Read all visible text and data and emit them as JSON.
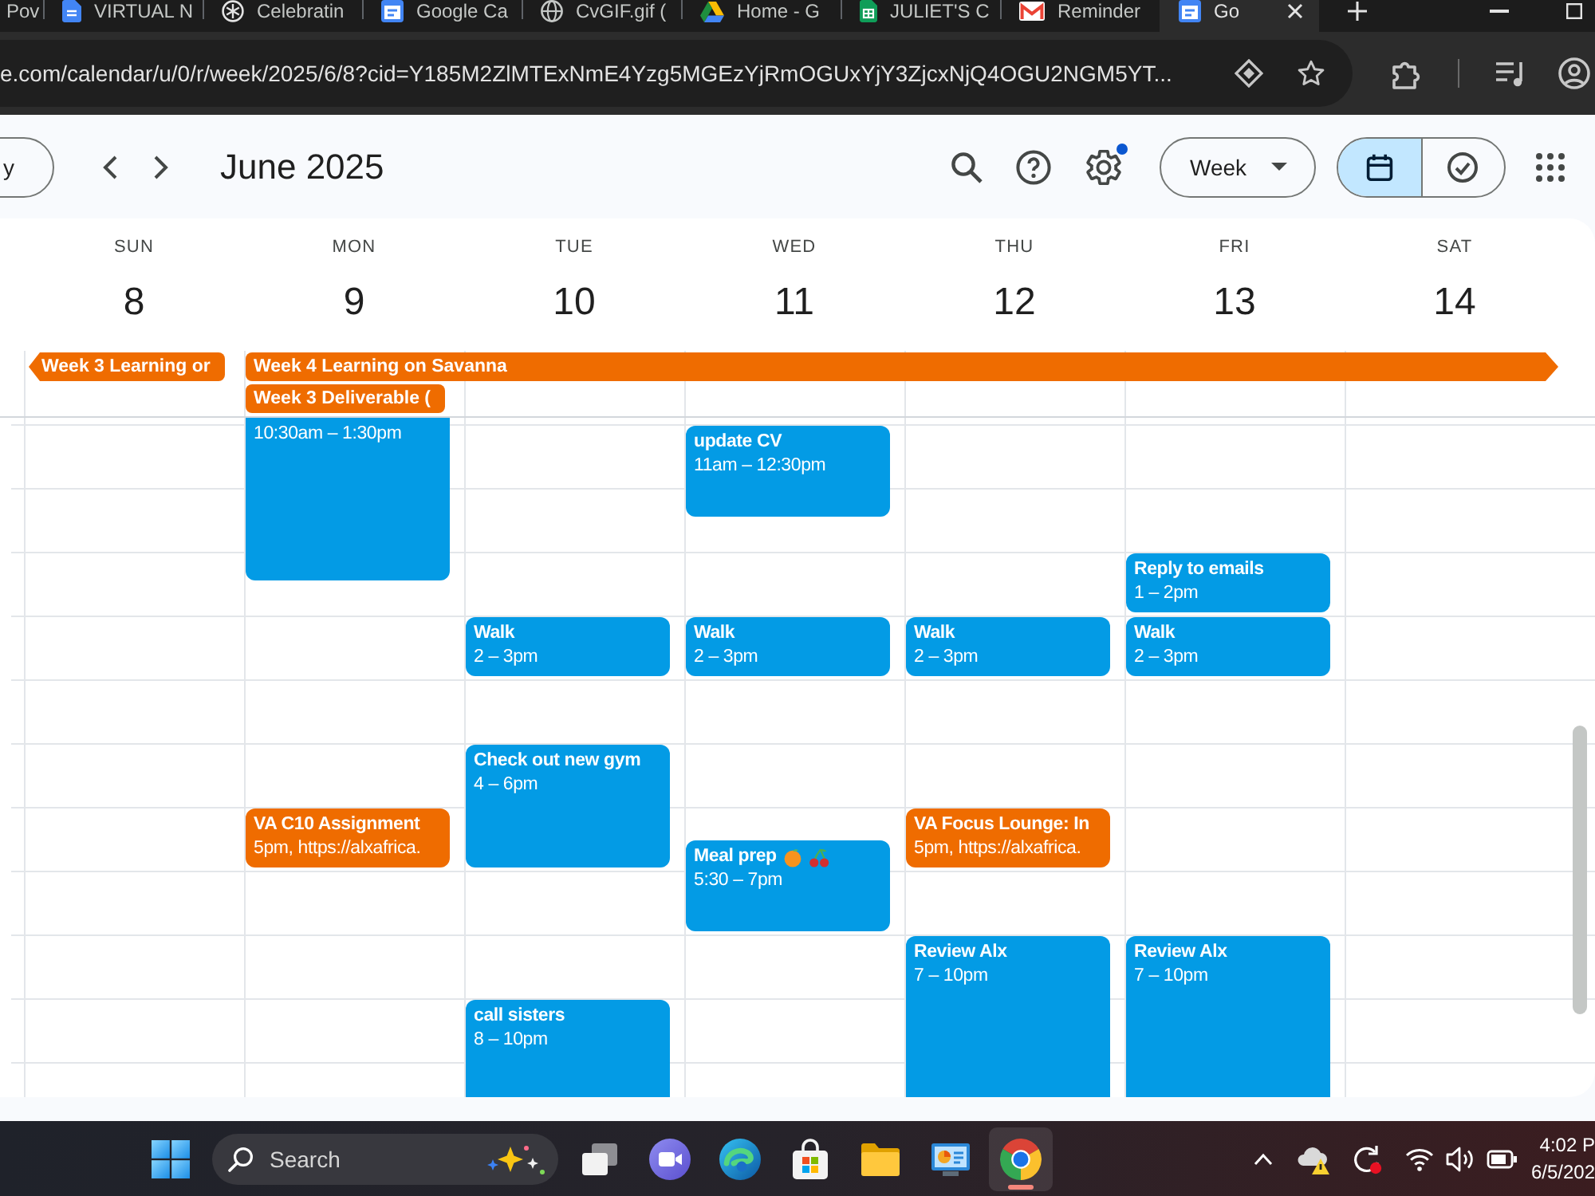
{
  "browser": {
    "tabs": [
      {
        "title": "Pov",
        "selected": false
      },
      {
        "title": "VIRTUAL N",
        "selected": false
      },
      {
        "title": "Celebratin",
        "selected": false
      },
      {
        "title": "Google Ca",
        "selected": false
      },
      {
        "title": "CvGIF.gif (",
        "selected": false
      },
      {
        "title": "Home - G",
        "selected": false
      },
      {
        "title": "JULIET'S C",
        "selected": false
      },
      {
        "title": "Reminder",
        "selected": false
      },
      {
        "title": "Go",
        "selected": true
      }
    ],
    "address_bar": {
      "url": "e.com/calendar/u/0/r/week/2025/6/8?cid=Y185M2ZlMTExNmE4Yzg5MGEzYjRmOGUxYjY3ZjcxNjQ4OGU2NGM5YT..."
    }
  },
  "calendar_header": {
    "today_button": "y",
    "title": "June 2025",
    "settings_notification": true,
    "view_menu": "Week",
    "view_switcher": [
      {
        "selected": true
      },
      {
        "selected": false
      }
    ]
  },
  "week": {
    "days": [
      {
        "name": "SUN",
        "date": "8"
      },
      {
        "name": "MON",
        "date": "9",
        "events": [
          {
            "time": "10:30am – 1:30pm",
            "color": "#039be5"
          },
          {
            "title": "VA C10 Assignment",
            "time": "5pm, https://alxafrica.",
            "color": "#ef6c00"
          }
        ]
      },
      {
        "name": "TUE",
        "date": "10",
        "events": [
          {
            "title": "Walk",
            "time": "2 – 3pm",
            "color": "#039be5"
          },
          {
            "title": "Check out new gym",
            "time": "4 – 6pm",
            "color": "#039be5"
          },
          {
            "title": "call sisters",
            "time": "8 – 10pm",
            "color": "#039be5"
          }
        ]
      },
      {
        "name": "WED",
        "date": "11",
        "events": [
          {
            "title": "update CV",
            "time": "11am – 12:30pm",
            "color": "#039be5"
          },
          {
            "title": "Walk",
            "time": "2 – 3pm",
            "color": "#039be5"
          },
          {
            "title": "Meal prep",
            "time": "5:30 – 7pm",
            "color": "#039be5"
          }
        ]
      },
      {
        "name": "THU",
        "date": "12",
        "events": [
          {
            "title": "Walk",
            "time": "2 – 3pm",
            "color": "#039be5"
          },
          {
            "title": "VA Focus Lounge: In",
            "time": "5pm, https://alxafrica.",
            "color": "#ef6c00"
          },
          {
            "title": "Review Alx",
            "time": "7 – 10pm",
            "color": "#039be5"
          }
        ]
      },
      {
        "name": "FRI",
        "date": "13",
        "events": [
          {
            "title": "Reply to emails",
            "time": "1 – 2pm",
            "color": "#039be5"
          },
          {
            "title": "Walk",
            "time": "2 – 3pm",
            "color": "#039be5"
          },
          {
            "title": "Review Alx",
            "time": "7 – 10pm",
            "color": "#039be5"
          }
        ]
      },
      {
        "name": "SAT",
        "date": "14"
      }
    ],
    "all_day_events": [
      {
        "title": "Week 3 Learning or",
        "color": "#ef6c00",
        "continues_before": true,
        "continues_after": false
      },
      {
        "title": "Week 4 Learning on Savanna",
        "color": "#ef6c00",
        "continues_before": false,
        "continues_after": true
      },
      {
        "title": "Week 3 Deliverable (",
        "color": "#ef6c00",
        "continues_before": false,
        "continues_after": false
      }
    ]
  },
  "taskbar": {
    "search": {
      "placeholder": "Search"
    },
    "apps": [
      {
        "selected": false
      },
      {
        "selected": false
      },
      {
        "selected": false
      },
      {
        "selected": false
      },
      {
        "selected": false
      },
      {
        "selected": false
      },
      {
        "selected": true
      }
    ],
    "clock": {
      "time": "4:02 P",
      "date": "6/5/202"
    }
  }
}
